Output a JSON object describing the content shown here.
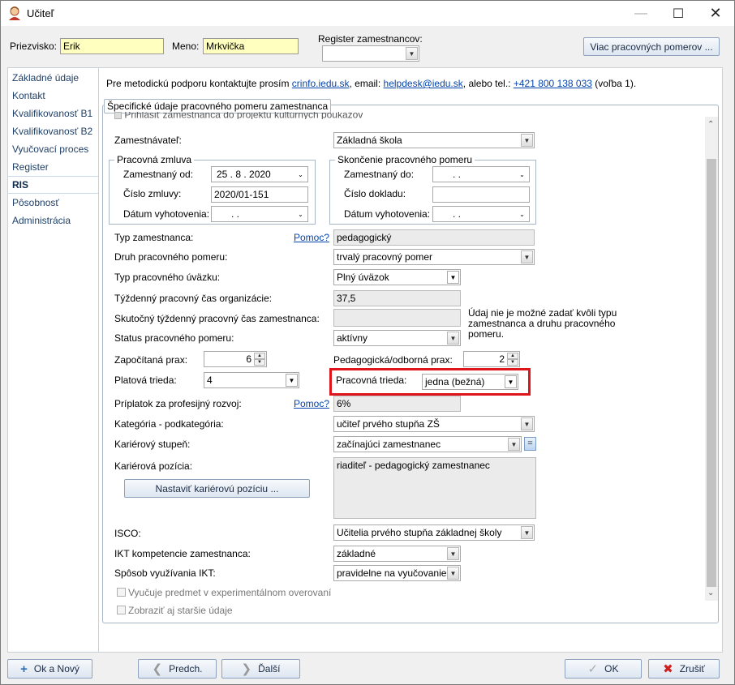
{
  "window": {
    "title": "Učiteľ"
  },
  "header": {
    "surname_label": "Priezvisko:",
    "surname_value": "Erik",
    "name_label": "Meno:",
    "name_value": "Mrkvička",
    "register_label": "Register zamestnancov:",
    "register_value": "",
    "more_button": "Viac pracovných pomerov ..."
  },
  "sidebar": {
    "items": [
      {
        "label": "Základné údaje"
      },
      {
        "label": "Kontakt"
      },
      {
        "label": "Kvalifikovanosť B1"
      },
      {
        "label": "Kvalifikovanosť B2"
      },
      {
        "label": "Vyučovací proces"
      },
      {
        "label": "Register"
      },
      {
        "label": "RIS"
      },
      {
        "label": "Pôsobnosť"
      },
      {
        "label": "Administrácia"
      }
    ],
    "active_index": 6
  },
  "info": {
    "pre": "Pre metodickú podporu kontaktujte prosím",
    "link1": "crinfo.iedu.sk",
    "mid1": ", email:",
    "link2": "helpdesk@iedu.sk",
    "mid2": ", alebo tel.:",
    "link3": "+421 800 138 033",
    "post": "(voľba 1)."
  },
  "panel": {
    "title": "Špecifické údaje pracovného pomeru zamestnanca",
    "cut_row": "Prihlásiť zamestnanca do projektu kultúrnych poukazov",
    "employer_label": "Zamestnávateľ:",
    "employer_value": "Základná škola",
    "contract_group": "Pracovná zmluva",
    "employed_from_label": "Zamestnaný od:",
    "employed_from_value": "25 .   8 .  2020",
    "contract_number_label": "Číslo zmluvy:",
    "contract_number_value": "2020/01-151",
    "issue_date_label": "Dátum vyhotovenia:",
    "issue_date_value": ".      .",
    "end_group": "Skončenie pracovného pomeru",
    "employed_to_label": "Zamestnaný do:",
    "employed_to_value": ".      .",
    "doc_number_label": "Číslo dokladu:",
    "doc_number_value": "",
    "end_issue_date_label": "Dátum vyhotovenia:",
    "end_issue_date_value": ".      .",
    "emp_type_label": "Typ zamestnanca:",
    "help_label": "Pomoc?",
    "emp_type_value": "pedagogický",
    "relation_kind_label": "Druh pracovného pomeru:",
    "relation_kind_value": "trvalý pracovný pomer",
    "workload_label": "Typ pracovného úväzku:",
    "workload_value": "Plný úväzok",
    "weekly_org_label": "Týždenný pracovný čas organizácie:",
    "weekly_org_value": "37,5",
    "weekly_actual_label": "Skutočný týždenný pracovný čas zamestnanca:",
    "weekly_actual_value": "",
    "weekly_note": "Údaj nie je možné zadať kvôli typu zamestnanca a druhu pracovného pomeru.",
    "status_label": "Status pracovného pomeru:",
    "status_value": "aktívny",
    "counted_practice_label": "Započítaná prax:",
    "counted_practice_value": "6",
    "ped_practice_label": "Pedagogická/odborná prax:",
    "ped_practice_value": "2",
    "salary_class_label": "Platová trieda:",
    "salary_class_value": "4",
    "work_class_label": "Pracovná trieda:",
    "work_class_value": "jedna (bežná)",
    "professional_bonus_label": "Príplatok za profesijný rozvoj:",
    "professional_bonus_value": "6%",
    "category_label": "Kategória - podkategória:",
    "category_value": "učiteľ prvého stupňa ZŠ",
    "career_level_label": "Kariérový stupeň:",
    "career_level_value": "začínajúci zamestnanec",
    "career_position_label": "Kariérová pozícia:",
    "career_position_value": "riaditeľ - pedagogický zamestnanec",
    "set_career_button": "Nastaviť kariérovú pozíciu ...",
    "isco_label": "ISCO:",
    "isco_value": "Učitelia prvého stupňa základnej školy",
    "ict_label": "IKT kompetencie zamestnanca:",
    "ict_value": "základné",
    "ict_usage_label": "Spôsob využívania IKT:",
    "ict_usage_value": "pravidelne na vyučovanie",
    "experimental_label": "Vyučuje predmet v experimentálnom overovaní",
    "show_old_label": "Zobraziť aj staršie údaje"
  },
  "footer": {
    "ok_new": "Ok a Nový",
    "prev": "Predch.",
    "next": "Ďalší",
    "ok": "OK",
    "cancel": "Zrušiť"
  },
  "colors": {
    "highlight": "#e0141b",
    "accent": "#1f3f66"
  },
  "icons": [
    "user-icon",
    "minimize-icon",
    "maximize-icon",
    "close-icon",
    "plus-icon",
    "chevron-left-icon",
    "chevron-right-icon",
    "check-icon",
    "cancel-icon"
  ]
}
